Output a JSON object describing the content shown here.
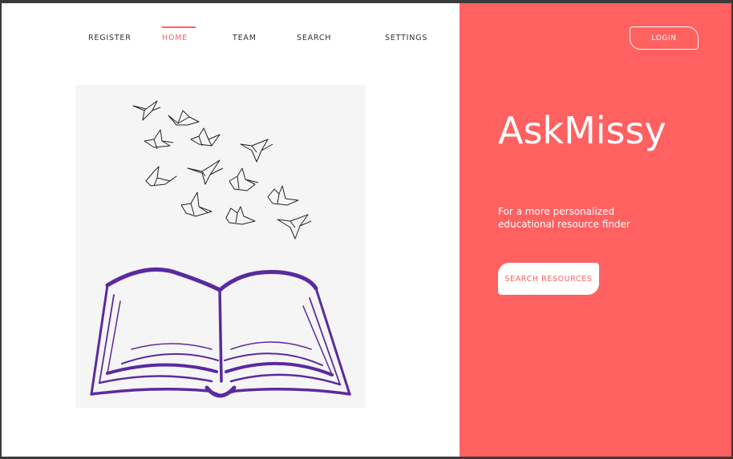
{
  "nav": {
    "items": [
      {
        "label": "REGISTER",
        "active": false
      },
      {
        "label": "HOME",
        "active": true
      },
      {
        "label": "TEAM",
        "active": false
      },
      {
        "label": "SEARCH",
        "active": false
      },
      {
        "label": "SETTINGS",
        "active": false
      }
    ]
  },
  "illustration": {
    "icon": "open-book-with-origami-birds",
    "book_color": "#5b2a9e",
    "bird_color": "#222222"
  },
  "hero": {
    "login_label": "LOGIN",
    "title": "AskMissy",
    "tagline": "For a more  personalized educational resource finder",
    "cta_label": "SEARCH RESOURCES"
  },
  "colors": {
    "accent": "#ff6161",
    "background": "#ffffff"
  }
}
